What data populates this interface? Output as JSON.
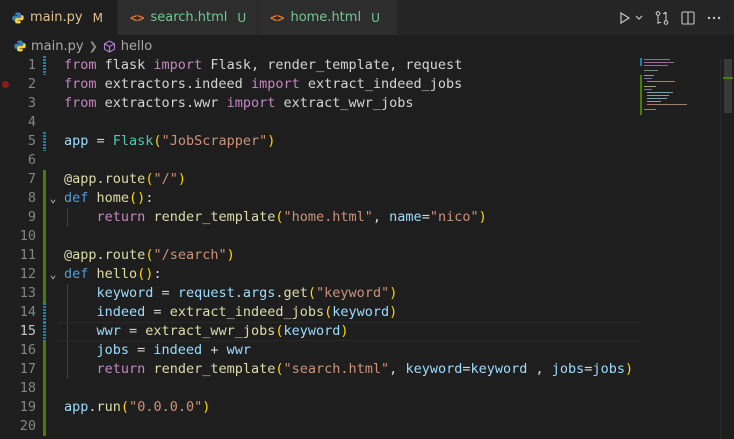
{
  "tabs": [
    {
      "label": "main.py",
      "status": "M",
      "icon": "python-icon",
      "active": true
    },
    {
      "label": "search.html",
      "status": "U",
      "icon": "html-icon",
      "active": false
    },
    {
      "label": "home.html",
      "status": "U",
      "icon": "html-icon",
      "active": false
    }
  ],
  "actions": [
    "run-icon",
    "dropdown-icon",
    "compare-changes-icon",
    "split-editor-icon",
    "more-icon"
  ],
  "breadcrumb": {
    "file": "main.py",
    "symbol": "hello"
  },
  "current_line": 15,
  "lines": [
    {
      "n": "1"
    },
    {
      "n": "2"
    },
    {
      "n": "3"
    },
    {
      "n": "4"
    },
    {
      "n": "5"
    },
    {
      "n": "6"
    },
    {
      "n": "7"
    },
    {
      "n": "8"
    },
    {
      "n": "9"
    },
    {
      "n": "10"
    },
    {
      "n": "11"
    },
    {
      "n": "12"
    },
    {
      "n": "13"
    },
    {
      "n": "14"
    },
    {
      "n": "15"
    },
    {
      "n": "16"
    },
    {
      "n": "17"
    },
    {
      "n": "18"
    },
    {
      "n": "19"
    },
    {
      "n": "20"
    }
  ],
  "code": {
    "l1": [
      "from",
      " flask ",
      "import",
      " Flask, ",
      "render_template",
      ", ",
      "request"
    ],
    "l2": [
      "from",
      " extractors.indeed ",
      "import",
      " ",
      "extract_indeed_jobs"
    ],
    "l3": [
      "from",
      " extractors.wwr ",
      "import",
      " ",
      "extract_wwr_jobs"
    ],
    "l5": [
      "app",
      " = ",
      "Flask",
      "(",
      "\"JobScrapper\"",
      ")"
    ],
    "l7": [
      "@",
      "app",
      ".",
      "route",
      "(",
      "\"/\"",
      ")"
    ],
    "l8": [
      "def",
      " ",
      "home",
      "()",
      ":"
    ],
    "l9": [
      "return",
      " ",
      "render_template",
      "(",
      "\"home.html\"",
      ", ",
      "name",
      "=",
      "\"nico\"",
      ")"
    ],
    "l11": [
      "@",
      "app",
      ".",
      "route",
      "(",
      "\"/search\"",
      ")"
    ],
    "l12": [
      "def",
      " ",
      "hello",
      "()",
      ":"
    ],
    "l13": [
      "keyword",
      " = ",
      "request",
      ".",
      "args",
      ".",
      "get",
      "(",
      "\"keyword\"",
      ")"
    ],
    "l14": [
      "indeed",
      " = ",
      "extract_indeed_jobs",
      "(",
      "keyword",
      ")"
    ],
    "l15": [
      "wwr",
      " = ",
      "extract_wwr_jobs",
      "(",
      "keyword",
      ")"
    ],
    "l16": [
      "jobs",
      " = ",
      "indeed",
      " + ",
      "wwr"
    ],
    "l17": [
      "return",
      " ",
      "render_template",
      "(",
      "\"search.html\"",
      ", ",
      "keyword",
      "=",
      "keyword",
      " , ",
      "jobs",
      "=",
      "jobs",
      ")"
    ],
    "l19": [
      "app",
      ".",
      "run",
      "(",
      "\"0.0.0.0\"",
      ")"
    ]
  },
  "colors": {
    "keyword": "#c586c0",
    "def": "#569cd6",
    "function": "#dcdcaa",
    "variable": "#9cdcfe",
    "class": "#4ec9b0",
    "string": "#ce9178",
    "git_modified": "#1b81a8",
    "git_added": "#487e02",
    "breakpoint": "#8b1a1a"
  }
}
